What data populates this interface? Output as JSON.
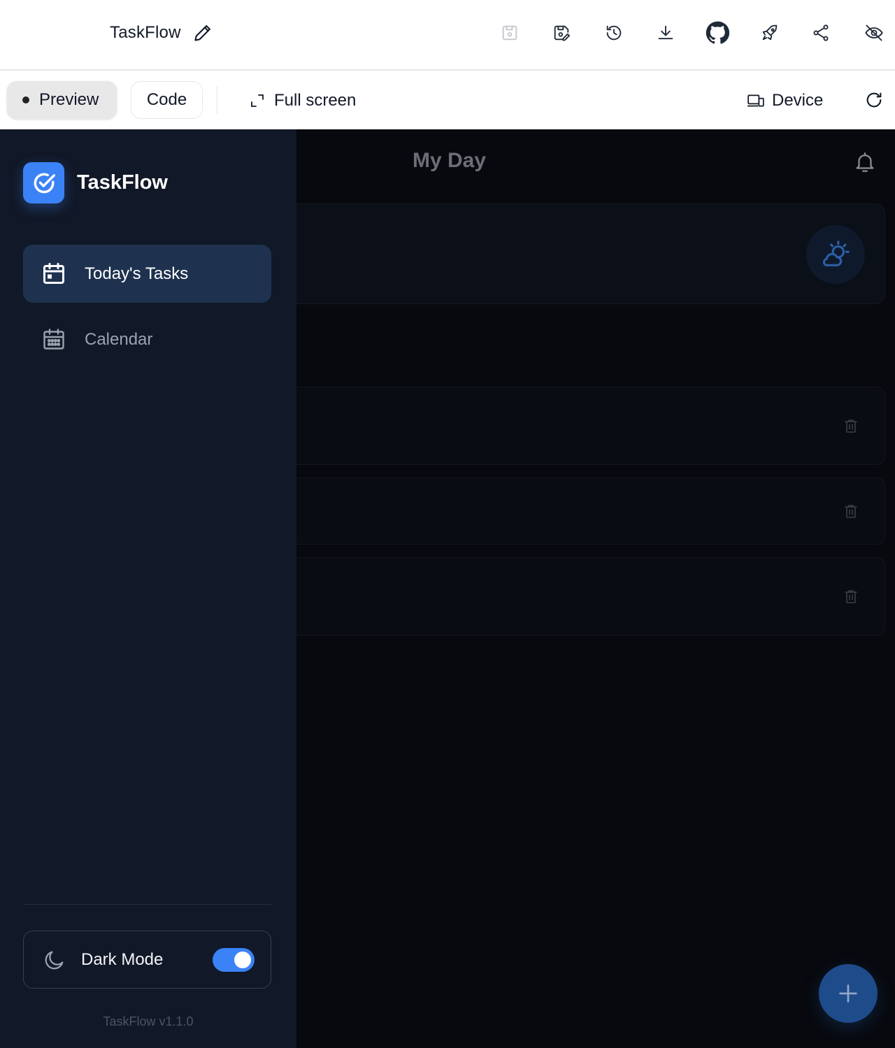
{
  "topbar": {
    "project_title": "TaskFlow",
    "icons": [
      "edit-icon",
      "save-icon",
      "save-edit-icon",
      "history-icon",
      "download-icon",
      "github-icon",
      "deploy-icon",
      "share-icon",
      "hide-icon"
    ]
  },
  "toolbar": {
    "preview_label": "Preview",
    "code_label": "Code",
    "fullscreen_label": "Full screen",
    "device_label": "Device"
  },
  "sidebar": {
    "brand": "TaskFlow",
    "nav": [
      {
        "label": "Today's Tasks",
        "icon": "calendar-day-icon",
        "active": true
      },
      {
        "label": "Calendar",
        "icon": "calendar-icon",
        "active": false
      }
    ],
    "dark_mode_label": "Dark Mode",
    "dark_mode_on": true,
    "version": "TaskFlow v1.1.0"
  },
  "main": {
    "title": "My Day"
  },
  "colors": {
    "accent": "#3b82f6",
    "sidebar_bg": "#111827",
    "active_nav_bg": "#1e3250",
    "app_bg": "#07090e"
  }
}
